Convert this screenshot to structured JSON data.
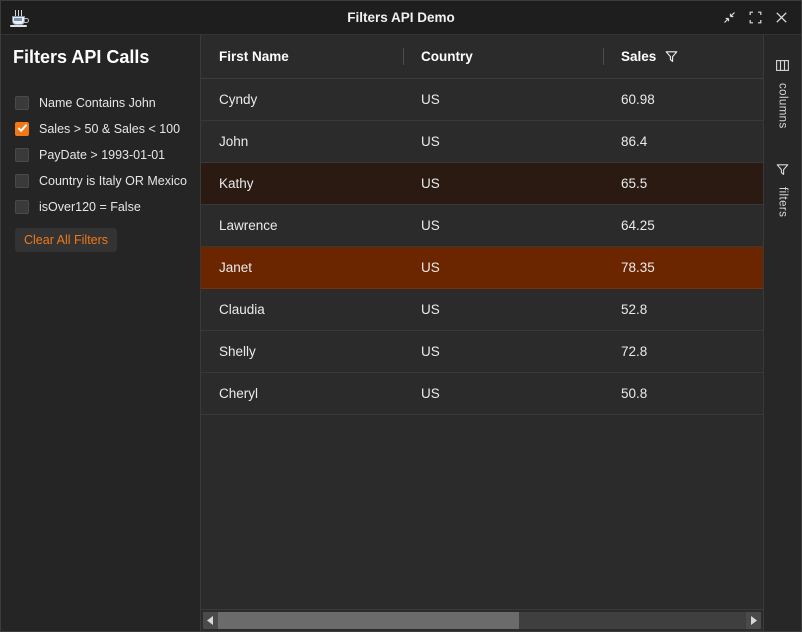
{
  "window": {
    "title": "Filters API Demo",
    "app_icon": "java-coffee-cup-icon",
    "controls": [
      {
        "name": "collapse-button",
        "icon": "collapse-arrows-icon"
      },
      {
        "name": "maximize-button",
        "icon": "maximize-brackets-icon"
      },
      {
        "name": "close-button",
        "icon": "close-x-icon"
      }
    ]
  },
  "sidebar": {
    "title": "Filters API Calls",
    "filters": [
      {
        "label": "Name Contains John",
        "checked": false
      },
      {
        "label": "Sales > 50 & Sales < 100",
        "checked": true
      },
      {
        "label": "PayDate > 1993-01-01",
        "checked": false
      },
      {
        "label": "Country is Italy OR Mexico",
        "checked": false
      },
      {
        "label": "isOver120 = False",
        "checked": false
      }
    ],
    "clear_button": "Clear All Filters"
  },
  "grid": {
    "columns": [
      {
        "label": "First Name",
        "has_filter_icon": false
      },
      {
        "label": "Country",
        "has_filter_icon": false
      },
      {
        "label": "Sales",
        "has_filter_icon": true
      }
    ],
    "rows": [
      {
        "first_name": "Cyndy",
        "country": "US",
        "sales": "60.98",
        "state": "normal"
      },
      {
        "first_name": "John",
        "country": "US",
        "sales": "86.4",
        "state": "normal"
      },
      {
        "first_name": "Kathy",
        "country": "US",
        "sales": "65.5",
        "state": "hovered"
      },
      {
        "first_name": "Lawrence",
        "country": "US",
        "sales": "64.25",
        "state": "normal"
      },
      {
        "first_name": "Janet",
        "country": "US",
        "sales": "78.35",
        "state": "selected"
      },
      {
        "first_name": "Claudia",
        "country": "US",
        "sales": "52.8",
        "state": "normal"
      },
      {
        "first_name": "Shelly",
        "country": "US",
        "sales": "72.8",
        "state": "normal"
      },
      {
        "first_name": "Cheryl",
        "country": "US",
        "sales": "50.8",
        "state": "normal"
      }
    ]
  },
  "rail": {
    "tabs": [
      {
        "label": "columns",
        "icon": "columns-icon"
      },
      {
        "label": "filters",
        "icon": "funnel-icon"
      }
    ]
  },
  "colors": {
    "accent": "#f07818",
    "selected_row": "#6b2600",
    "hovered_row": "#2a1a12",
    "window_bg": "#2b2b2b",
    "sidebar_bg": "#252525",
    "titlebar_bg": "#1e1e1e"
  }
}
